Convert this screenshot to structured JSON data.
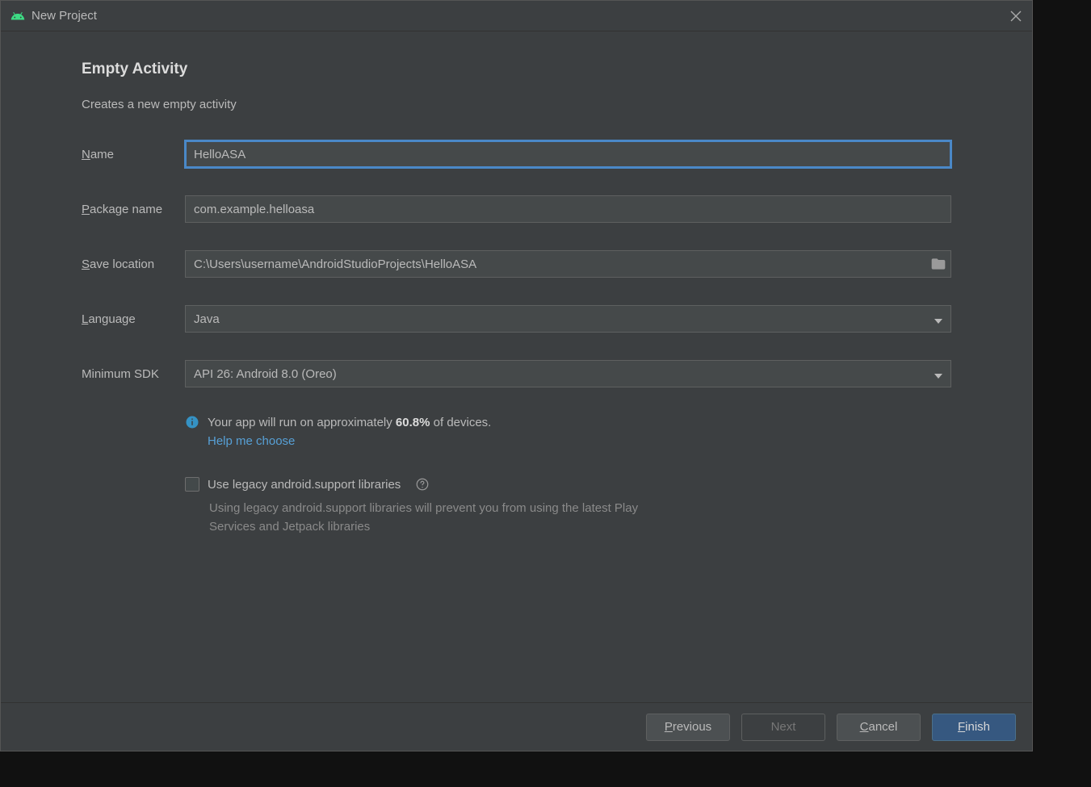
{
  "window": {
    "title": "New Project"
  },
  "page": {
    "heading": "Empty Activity",
    "subheading": "Creates a new empty activity"
  },
  "form": {
    "name": {
      "label_pre": "N",
      "label_rest": "ame",
      "value": "HelloASA"
    },
    "package": {
      "label_pre": "P",
      "label_rest": "ackage name",
      "value": "com.example.helloasa"
    },
    "save": {
      "label_pre": "S",
      "label_rest": "ave location",
      "value": "C:\\Users\\username\\AndroidStudioProjects\\HelloASA"
    },
    "language": {
      "label_pre": "L",
      "label_rest": "anguage",
      "value": "Java"
    },
    "minsdk": {
      "label": "Minimum SDK",
      "value": "API 26: Android 8.0 (Oreo)"
    }
  },
  "info": {
    "text_before": "Your app will run on approximately ",
    "percent": "60.8%",
    "text_after": " of devices.",
    "help_link": "Help me choose"
  },
  "legacy": {
    "label": "Use legacy android.support libraries",
    "checked": false,
    "description": "Using legacy android.support libraries will prevent you from using the latest Play Services and Jetpack libraries"
  },
  "footer": {
    "previous": {
      "pre": "P",
      "rest": "revious"
    },
    "next": "Next",
    "cancel": {
      "pre": "C",
      "rest": "ancel"
    },
    "finish": {
      "pre": "F",
      "rest": "inish"
    }
  }
}
